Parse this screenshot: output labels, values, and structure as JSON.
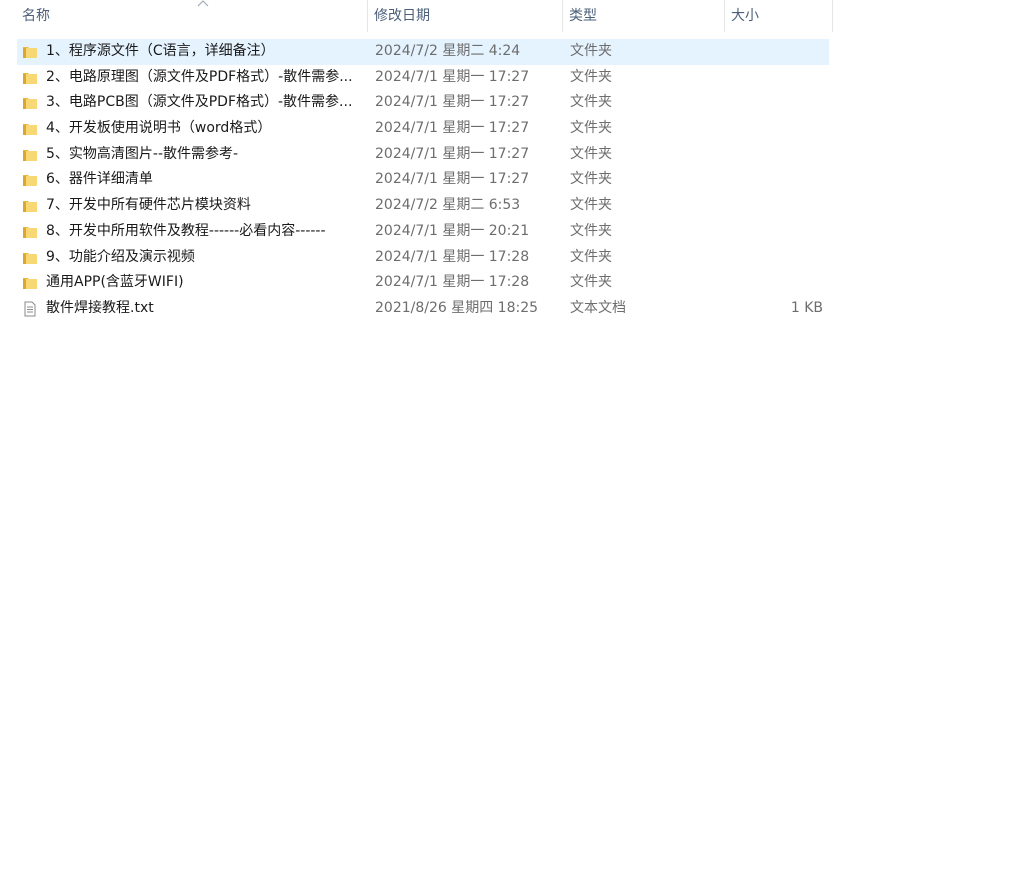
{
  "columns": {
    "name": "名称",
    "date": "修改日期",
    "type": "类型",
    "size": "大小"
  },
  "colors": {
    "header_text": "#4c607a",
    "selected_row": "#e5f3ff",
    "folder_yellow": "#f8d775",
    "secondary_text": "#6d6d6d"
  },
  "rows": [
    {
      "icon": "folder-icon",
      "name": "1、程序源文件（C语言，详细备注）",
      "date": "2024/7/2 星期二 4:24",
      "type": "文件夹",
      "size": ""
    },
    {
      "icon": "folder-icon",
      "name": "2、电路原理图（源文件及PDF格式）-散件需参...",
      "date": "2024/7/1 星期一 17:27",
      "type": "文件夹",
      "size": ""
    },
    {
      "icon": "folder-icon",
      "name": "3、电路PCB图（源文件及PDF格式）-散件需参...",
      "date": "2024/7/1 星期一 17:27",
      "type": "文件夹",
      "size": ""
    },
    {
      "icon": "folder-icon",
      "name": "4、开发板使用说明书（word格式）",
      "date": "2024/7/1 星期一 17:27",
      "type": "文件夹",
      "size": ""
    },
    {
      "icon": "folder-icon",
      "name": "5、实物高清图片--散件需参考-",
      "date": "2024/7/1 星期一 17:27",
      "type": "文件夹",
      "size": ""
    },
    {
      "icon": "folder-icon",
      "name": "6、器件详细清单",
      "date": "2024/7/1 星期一 17:27",
      "type": "文件夹",
      "size": ""
    },
    {
      "icon": "folder-icon",
      "name": "7、开发中所有硬件芯片模块资料",
      "date": "2024/7/2 星期二 6:53",
      "type": "文件夹",
      "size": ""
    },
    {
      "icon": "folder-icon",
      "name": "8、开发中所用软件及教程------必看内容------",
      "date": "2024/7/1 星期一 20:21",
      "type": "文件夹",
      "size": ""
    },
    {
      "icon": "folder-icon",
      "name": "9、功能介绍及演示视频",
      "date": "2024/7/1 星期一 17:28",
      "type": "文件夹",
      "size": ""
    },
    {
      "icon": "folder-icon",
      "name": "通用APP(含蓝牙WIFI)",
      "date": "2024/7/1 星期一 17:28",
      "type": "文件夹",
      "size": ""
    },
    {
      "icon": "text-file-icon",
      "name": "散件焊接教程.txt",
      "date": "2021/8/26 星期四 18:25",
      "type": "文本文档",
      "size": "1 KB"
    }
  ]
}
